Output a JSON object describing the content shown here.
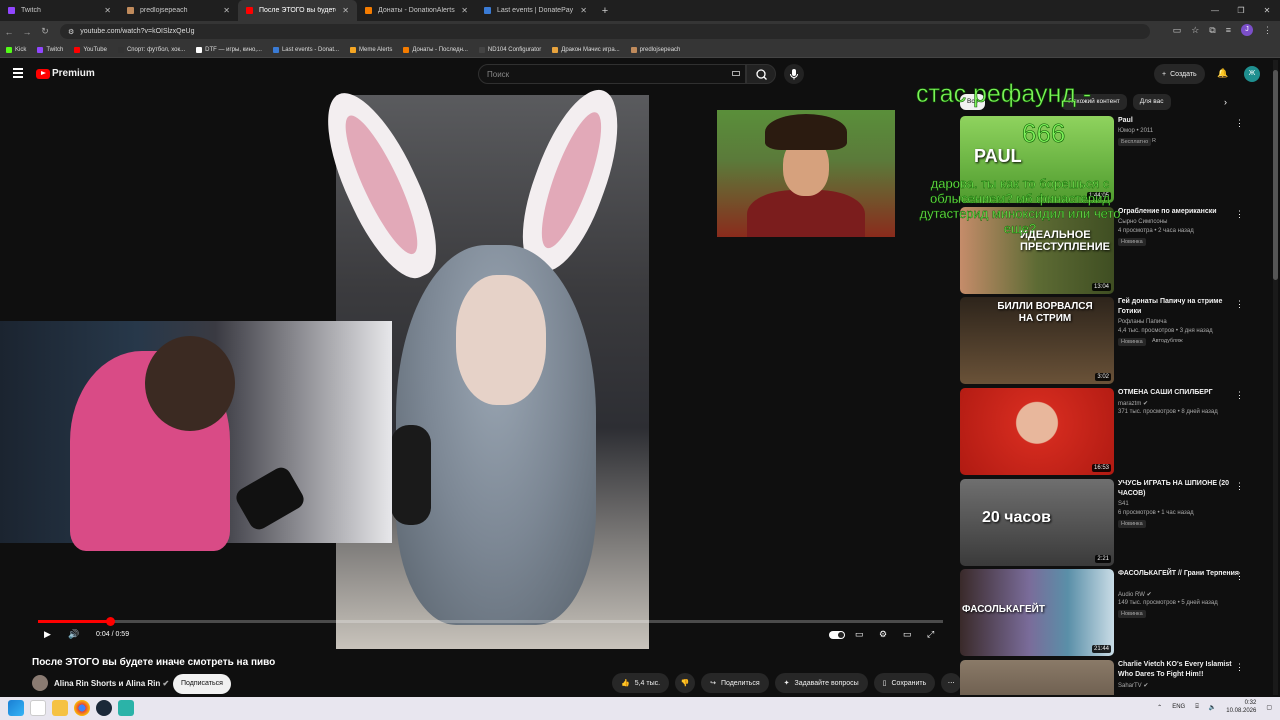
{
  "browser": {
    "tabs": [
      {
        "title": "Twitch",
        "color": "#9146ff",
        "active": false
      },
      {
        "title": "predlojsepeach",
        "color": "#c08b5c",
        "active": false
      },
      {
        "title": "После ЭТОГО вы будете иначе",
        "color": "#ff0000",
        "active": true
      },
      {
        "title": "Донаты - DonationAlerts",
        "color": "#f57c00",
        "active": false
      },
      {
        "title": "Last events | DonatePay",
        "color": "#3a7bd5",
        "active": false
      }
    ],
    "url": "youtube.com/watch?v=kOISlzxQeUg",
    "profile_initial": "J",
    "bookmarks": [
      {
        "label": "Kick",
        "color": "#53fc18"
      },
      {
        "label": "Twitch",
        "color": "#9146ff"
      },
      {
        "label": "YouTube",
        "color": "#ff0000"
      },
      {
        "label": "Спорт: футбол, хок...",
        "color": "#333333"
      },
      {
        "label": "DTF — игры, кино,...",
        "color": "#ffffff"
      },
      {
        "label": "Last events - Donat...",
        "color": "#3a7bd5"
      },
      {
        "label": "Meme Alerts",
        "color": "#f5a623"
      },
      {
        "label": "Донаты - Последн...",
        "color": "#f57c00"
      },
      {
        "label": "ND104 Configurator",
        "color": "#444444"
      },
      {
        "label": "Дракон Мачис игра...",
        "color": "#e8a33d"
      },
      {
        "label": "predlojsepeach",
        "color": "#c08b5c"
      }
    ]
  },
  "youtube": {
    "logo_text": "Premium",
    "search_placeholder": "Поиск",
    "create_label": "Создать",
    "avatar_initial": "Ж"
  },
  "player": {
    "time": "0:04 / 0:59",
    "progress_fraction": 0.08
  },
  "video": {
    "title": "После ЭТОГО вы будете иначе смотреть на пиво",
    "channel": "Alina Rin Shorts и Alina Rin",
    "subscribe_label": "Подписаться",
    "likes": "5,4 тыс.",
    "share_label": "Поделиться",
    "ask_label": "Задавайте вопросы",
    "save_label": "Сохранить"
  },
  "overlay": {
    "line1": "стас рефаунд -",
    "line2": "666",
    "message": "дарова. ты как то борешься с облысением? мб финастерид дутастерид миноксидил или чето еще?"
  },
  "chips": [
    "Все",
    "Похожий контент",
    "Для вас"
  ],
  "recommendations": [
    {
      "title": "Paul",
      "channel": "Юмор • 2011",
      "meta": "",
      "badge": "Бесплатно",
      "badge2": "R",
      "duration": "1:44:05",
      "thumb_bg": "#7ec850",
      "thumb_text": "PAUL"
    },
    {
      "title": "Ограбление по американски",
      "channel": "Сырно Симпсоны",
      "meta": "4 просмотра • 2 часа назад",
      "badge": "Новинка",
      "badge2": "",
      "duration": "13:04",
      "thumb_bg": "#4a5c2a",
      "thumb_text": "ИДЕАЛЬНОЕ ПРЕСТУПЛЕНИЕ"
    },
    {
      "title": "Гей донаты Папичу на стриме Готики",
      "channel": "Рофланы Папича",
      "meta": "4,4 тыс. просмотров • 3 дня назад",
      "badge": "Новинка",
      "badge2": "Автодубляж",
      "duration": "3:02",
      "thumb_bg": "#3a2e22",
      "thumb_text": "БИЛЛИ ВОРВАЛСЯ НА СТРИМ"
    },
    {
      "title": "ОТМЕНА САШИ СПИЛБЕРГ",
      "channel": "maraztm",
      "meta": "371 тыс. просмотров • 8 дней назад",
      "badge": "",
      "badge2": "",
      "duration": "16:53",
      "thumb_bg": "#d22a1e",
      "thumb_text": ""
    },
    {
      "title": "УЧУСЬ ИГРАТЬ НА ШПИОНЕ (20 ЧАСОВ)",
      "channel": "S41",
      "meta": "6 просмотров • 1 час назад",
      "badge": "Новинка",
      "badge2": "",
      "duration": "2:21",
      "thumb_bg": "#4d4d4d",
      "thumb_text": "20 часов"
    },
    {
      "title": "ФАСОЛЬКАГЕЙТ // Грани Терпения",
      "channel": "Audio RW",
      "meta": "149 тыс. просмотров • 5 дней назад",
      "badge": "Новинка",
      "badge2": "",
      "duration": "21:44",
      "thumb_bg": "#5a8fa8",
      "thumb_text": "ФАСОЛЬКАГЕЙТ"
    },
    {
      "title": "Charlie Vietch KO's Every Islamist Who Dares To Fight Him!!",
      "channel": "SaharTV",
      "meta": "",
      "badge": "",
      "badge2": "",
      "duration": "",
      "thumb_bg": "#6b5a48",
      "thumb_text": ""
    }
  ],
  "taskbar": {
    "lang": "ENG",
    "time": "0:32",
    "date": "10.08.2026"
  }
}
